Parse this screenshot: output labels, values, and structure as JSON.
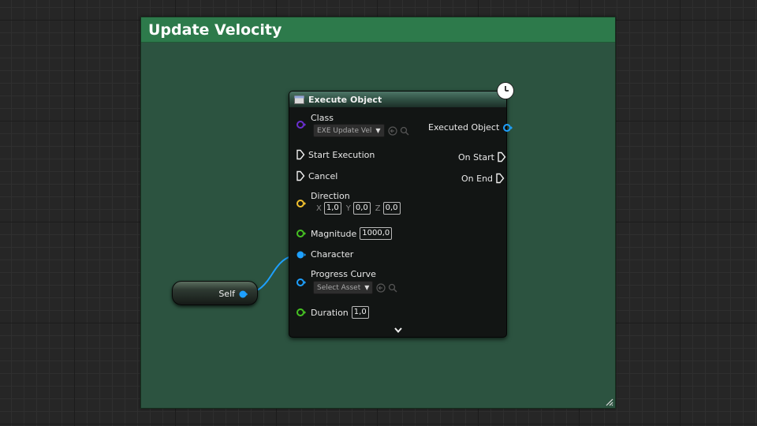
{
  "comment": {
    "title": "Update Velocity",
    "color": "#2d7a4b"
  },
  "node": {
    "title": "Execute Object",
    "latent_icon": "clock-icon",
    "class_pin": {
      "label": "Class",
      "value": "EXE Update Vel",
      "color": "#6a2fd1"
    },
    "executed_object": {
      "label": "Executed Object",
      "color": "#1ea0ff"
    },
    "start_execution": {
      "label": "Start Execution"
    },
    "cancel": {
      "label": "Cancel"
    },
    "on_start": {
      "label": "On Start"
    },
    "on_end": {
      "label": "On End"
    },
    "direction": {
      "label": "Direction",
      "color": "#f2c12e",
      "x_label": "X",
      "x": "1,0",
      "y_label": "Y",
      "y": "0,0",
      "z_label": "Z",
      "z": "0,0"
    },
    "magnitude": {
      "label": "Magnitude",
      "value": "1000,0",
      "color": "#46c223"
    },
    "character": {
      "label": "Character",
      "color": "#1ea0ff"
    },
    "progress_curve": {
      "label": "Progress Curve",
      "value": "Select Asset",
      "color": "#1ea0ff"
    },
    "duration": {
      "label": "Duration",
      "value": "1,0",
      "color": "#46c223"
    },
    "expand_icon": "chevron-down-icon"
  },
  "self_node": {
    "label": "Self",
    "color": "#1ea0ff"
  }
}
